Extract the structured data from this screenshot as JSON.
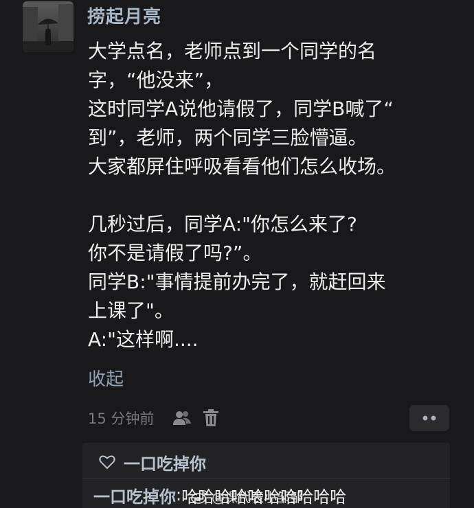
{
  "post": {
    "username": "捞起月亮",
    "avatar_icon": "avatar-icon",
    "lines": [
      "大学点名，老师点到一个同学的名",
      "字，“他没来”，",
      "这时同学A说他请假了，同学B喊了“",
      "到”，老师，两个同学三脸懵逼。",
      "大家都屏住呼吸看看他们怎么收场。",
      "",
      "几秒过后，同学A:\"你怎么来了?",
      "你不是请假了吗?”。",
      "同学B:\"事情提前办完了，就赶回来",
      "上课了\"。",
      "A:\"这样啊...."
    ],
    "collapse_label": "收起",
    "timestamp": "15 分钟前"
  },
  "likes": {
    "liker_name": "一口吃掉你"
  },
  "reply": {
    "author": "一口吃掉你",
    "separator": ":",
    "text": "哈哈哈哈哈哈哈哈哈哈"
  },
  "watermark": {
    "text": "@课代表小邹邹"
  },
  "colors": {
    "background": "#19191b",
    "username": "#a9b9c9",
    "body_text": "#ececec",
    "link": "#8ea0b6",
    "meta": "#7a7a7e",
    "panel": "#232325"
  }
}
